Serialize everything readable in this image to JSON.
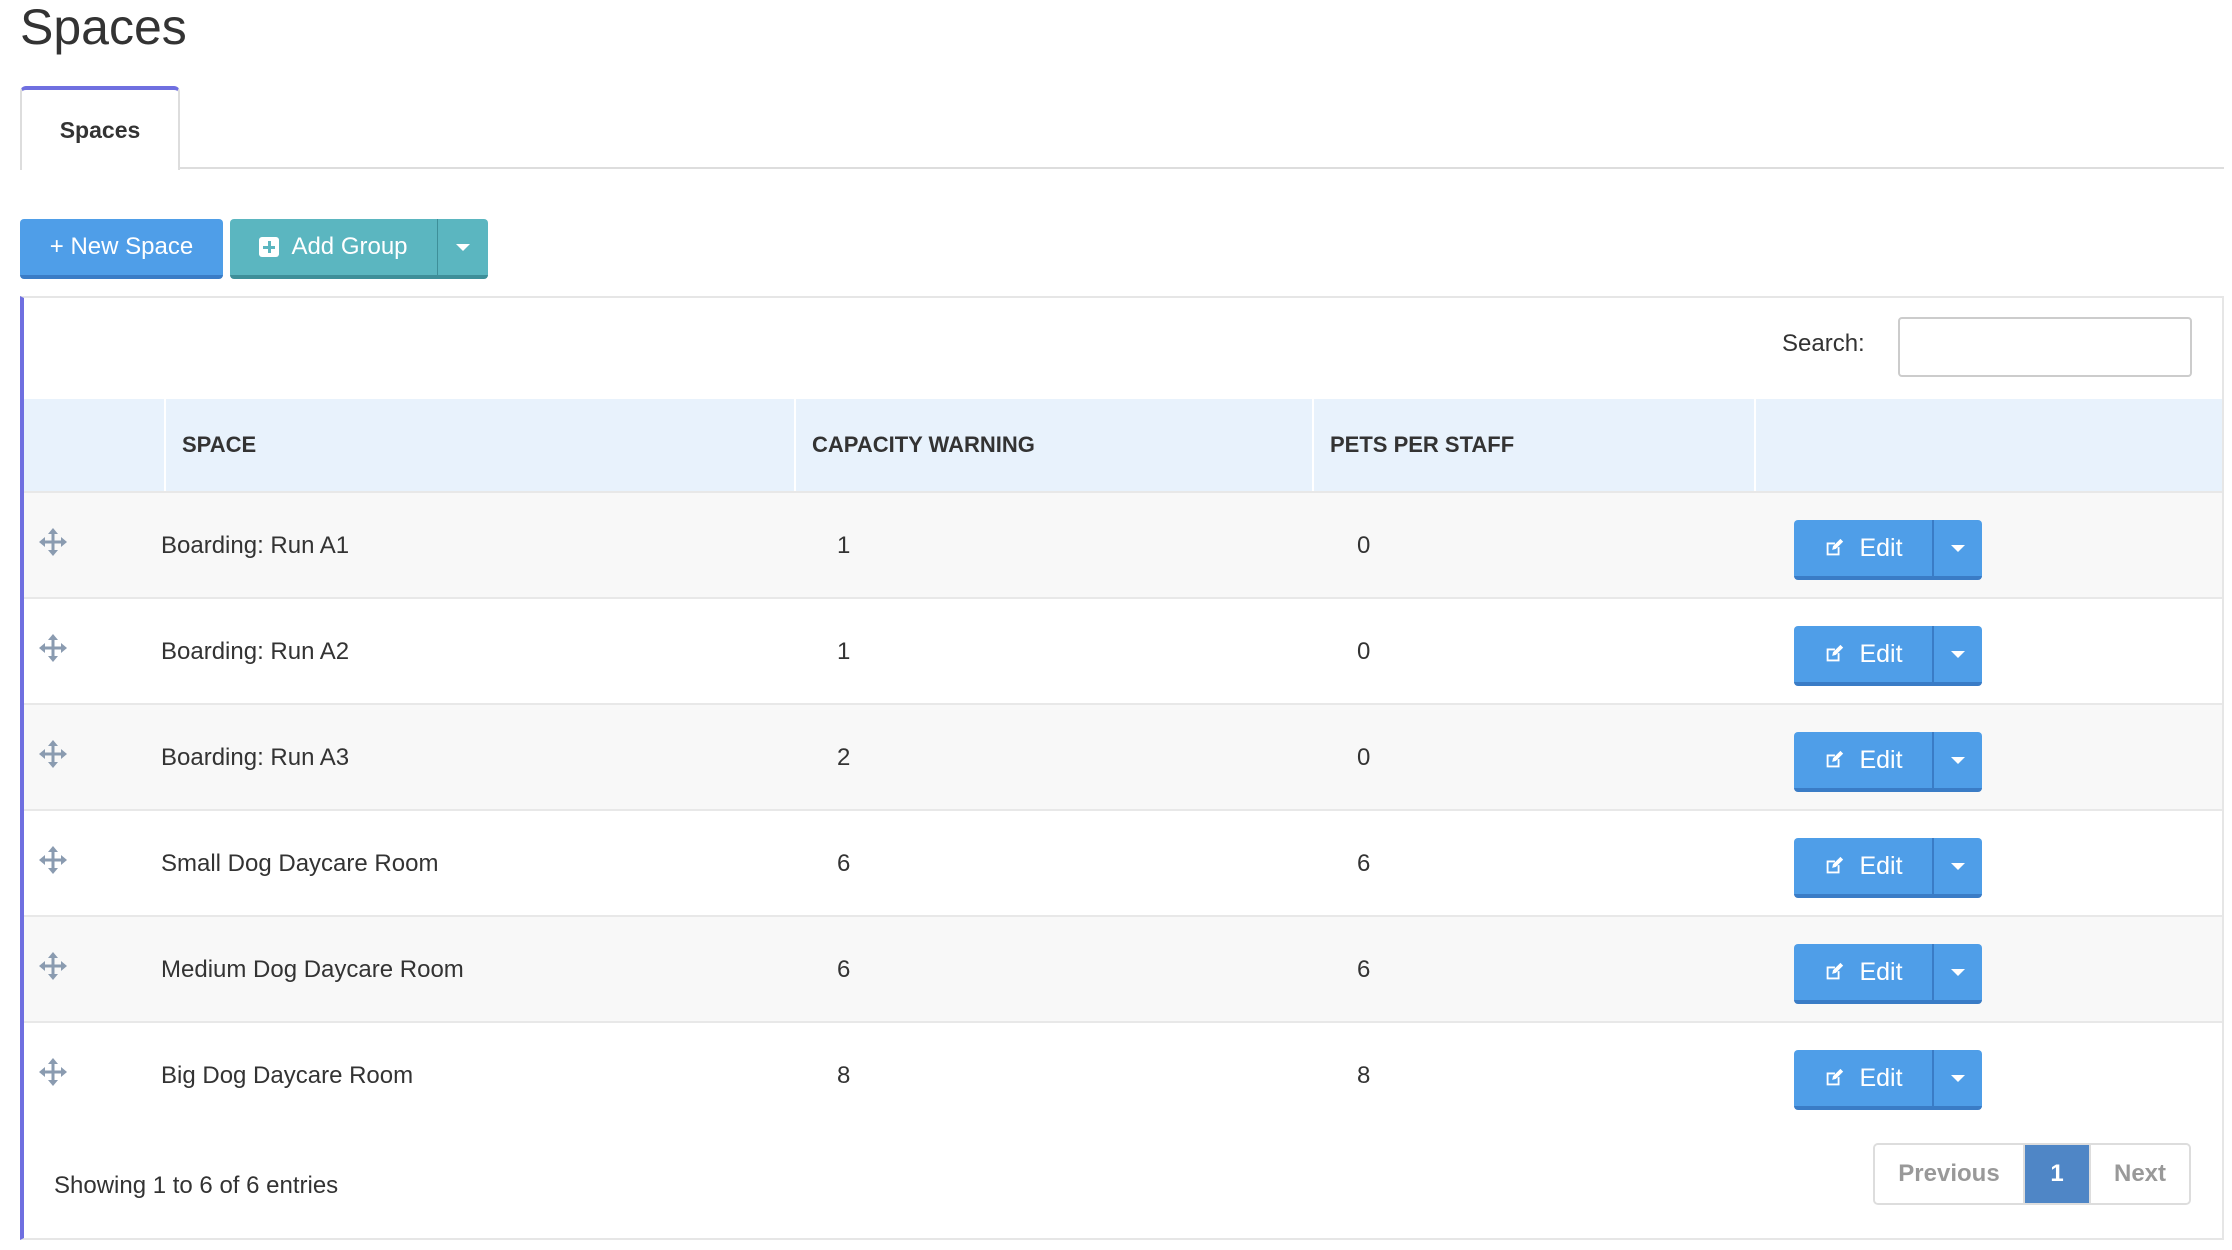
{
  "page": {
    "title": "Spaces"
  },
  "tabs": [
    {
      "label": "Spaces"
    }
  ],
  "toolbar": {
    "new_space_label": "+ New Space",
    "add_group_label": "Add Group"
  },
  "table": {
    "search_label": "Search:",
    "search_value": "",
    "columns": [
      "",
      "SPACE",
      "CAPACITY WARNING",
      "PETS PER STAFF",
      ""
    ],
    "edit_label": "Edit",
    "rows": [
      {
        "space": "Boarding: Run A1",
        "capacity_warning": "1",
        "pets_per_staff": "0"
      },
      {
        "space": "Boarding: Run A2",
        "capacity_warning": "1",
        "pets_per_staff": "0"
      },
      {
        "space": "Boarding: Run A3",
        "capacity_warning": "2",
        "pets_per_staff": "0"
      },
      {
        "space": "Small Dog Daycare Room",
        "capacity_warning": "6",
        "pets_per_staff": "6"
      },
      {
        "space": "Medium Dog Daycare Room",
        "capacity_warning": "6",
        "pets_per_staff": "6"
      },
      {
        "space": "Big Dog Daycare Room",
        "capacity_warning": "8",
        "pets_per_staff": "8"
      }
    ],
    "info": "Showing 1 to 6 of 6 entries"
  },
  "pagination": {
    "previous": "Previous",
    "current": "1",
    "next": "Next"
  },
  "colors": {
    "primary": "#4f9ee8",
    "teal": "#5bb6c0",
    "accent": "#6f6fe0",
    "header_bg": "#e8f2fc"
  }
}
